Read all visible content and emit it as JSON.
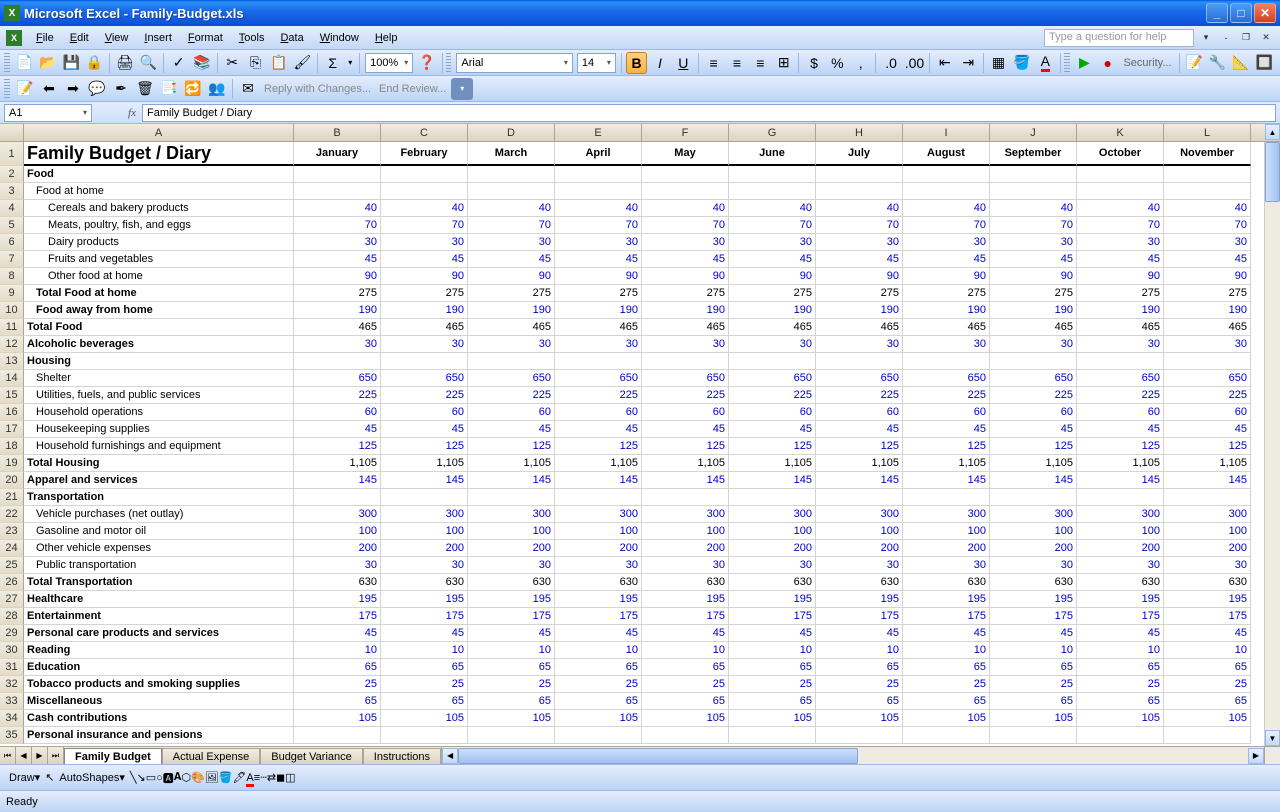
{
  "title": "Microsoft Excel - Family-Budget.xls",
  "menus": [
    "File",
    "Edit",
    "View",
    "Insert",
    "Format",
    "Tools",
    "Data",
    "Window",
    "Help"
  ],
  "helpPlaceholder": "Type a question for help",
  "zoom": "100%",
  "fontName": "Arial",
  "fontSize": "14",
  "reviewText": "Reply with Changes...",
  "endReview": "End Review...",
  "securityLabel": "Security...",
  "nameBox": "A1",
  "formulaValue": "Family Budget / Diary",
  "columns": [
    "A",
    "B",
    "C",
    "D",
    "E",
    "F",
    "G",
    "H",
    "I",
    "J",
    "K",
    "L"
  ],
  "months": [
    "January",
    "February",
    "March",
    "April",
    "May",
    "June",
    "July",
    "August",
    "September",
    "October",
    "November"
  ],
  "rowsData": [
    {
      "r": 1,
      "a": "Family Budget / Diary",
      "type": "title"
    },
    {
      "r": 2,
      "a": "Food",
      "type": "bold"
    },
    {
      "r": 3,
      "a": "Food at home",
      "type": "indent1"
    },
    {
      "r": 4,
      "a": "Cereals and bakery products",
      "type": "indent2",
      "v": 40,
      "last": "40"
    },
    {
      "r": 5,
      "a": "Meats, poultry, fish, and eggs",
      "type": "indent2",
      "v": 70,
      "last": "70"
    },
    {
      "r": 6,
      "a": "Dairy products",
      "type": "indent2",
      "v": 30,
      "last": "30"
    },
    {
      "r": 7,
      "a": "Fruits and vegetables",
      "type": "indent2",
      "v": 45,
      "last": "45"
    },
    {
      "r": 8,
      "a": "Other food at home",
      "type": "indent2",
      "v": 90,
      "last": "90"
    },
    {
      "r": 9,
      "a": "Total Food at home",
      "type": "indent1 bold",
      "v": 275,
      "tot": true,
      "last": "275"
    },
    {
      "r": 10,
      "a": "Food away from home",
      "type": "indent1 bold",
      "v": 190,
      "last": "190"
    },
    {
      "r": 11,
      "a": "Total Food",
      "type": "bold",
      "v": 465,
      "tot": true,
      "last": "465"
    },
    {
      "r": 12,
      "a": "Alcoholic beverages",
      "type": "bold",
      "v": 30,
      "last": "30"
    },
    {
      "r": 13,
      "a": "Housing",
      "type": "bold"
    },
    {
      "r": 14,
      "a": "Shelter",
      "type": "indent1",
      "v": 650,
      "last": "650"
    },
    {
      "r": 15,
      "a": "Utilities, fuels, and public services",
      "type": "indent1",
      "v": 225,
      "last": "225"
    },
    {
      "r": 16,
      "a": "Household operations",
      "type": "indent1",
      "v": 60,
      "last": "60"
    },
    {
      "r": 17,
      "a": "Housekeeping supplies",
      "type": "indent1",
      "v": 45,
      "last": "45"
    },
    {
      "r": 18,
      "a": "Household furnishings and equipment",
      "type": "indent1",
      "v": 125,
      "last": "125"
    },
    {
      "r": 19,
      "a": "Total Housing",
      "type": "bold",
      "v": "1,105",
      "tot": true,
      "last": "1,105"
    },
    {
      "r": 20,
      "a": "Apparel and services",
      "type": "bold",
      "v": 145,
      "last": "145"
    },
    {
      "r": 21,
      "a": "Transportation",
      "type": "bold"
    },
    {
      "r": 22,
      "a": "Vehicle purchases (net outlay)",
      "type": "indent1",
      "v": 300,
      "last": "300"
    },
    {
      "r": 23,
      "a": "Gasoline and motor oil",
      "type": "indent1",
      "v": 100,
      "last": "100"
    },
    {
      "r": 24,
      "a": "Other vehicle expenses",
      "type": "indent1",
      "v": 200,
      "last": "200"
    },
    {
      "r": 25,
      "a": "Public transportation",
      "type": "indent1",
      "v": 30,
      "last": "30"
    },
    {
      "r": 26,
      "a": "Total Transportation",
      "type": "bold",
      "v": 630,
      "tot": true,
      "last": "630"
    },
    {
      "r": 27,
      "a": "Healthcare",
      "type": "bold",
      "v": 195,
      "last": "195"
    },
    {
      "r": 28,
      "a": "Entertainment",
      "type": "bold",
      "v": 175,
      "last": "175"
    },
    {
      "r": 29,
      "a": "Personal care products and services",
      "type": "bold",
      "v": 45,
      "last": "45"
    },
    {
      "r": 30,
      "a": "Reading",
      "type": "bold",
      "v": 10,
      "last": "10"
    },
    {
      "r": 31,
      "a": "Education",
      "type": "bold",
      "v": 65,
      "last": "65"
    },
    {
      "r": 32,
      "a": "Tobacco products and smoking supplies",
      "type": "bold",
      "v": 25,
      "last": "25"
    },
    {
      "r": 33,
      "a": "Miscellaneous",
      "type": "bold",
      "v": 65,
      "last": "65"
    },
    {
      "r": 34,
      "a": "Cash contributions",
      "type": "bold",
      "v": 105,
      "last": "105"
    },
    {
      "r": 35,
      "a": "Personal insurance and pensions",
      "type": "bold"
    }
  ],
  "tabs": [
    "Family Budget",
    "Actual Expense",
    "Budget Variance",
    "Instructions"
  ],
  "activeTab": 0,
  "drawLabel": "Draw",
  "autoShapes": "AutoShapes",
  "status": "Ready"
}
